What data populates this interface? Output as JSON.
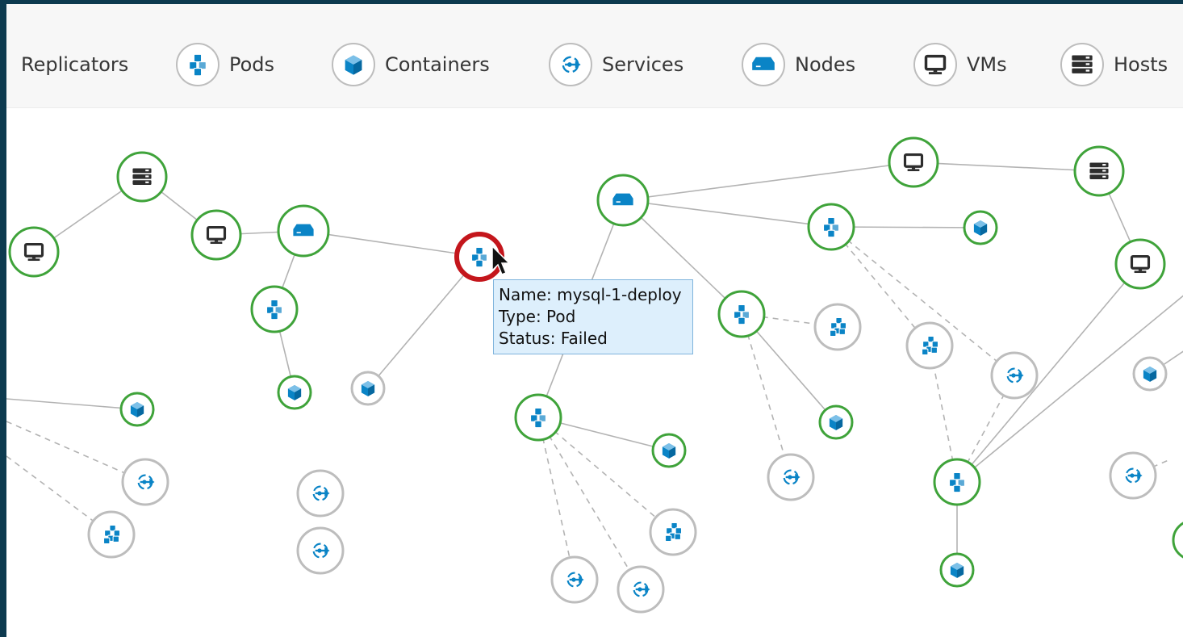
{
  "legend": {
    "items": [
      {
        "label": "Replicators",
        "icon": "replicator-icon"
      },
      {
        "label": "Pods",
        "icon": "pod-icon"
      },
      {
        "label": "Containers",
        "icon": "container-icon"
      },
      {
        "label": "Services",
        "icon": "service-icon"
      },
      {
        "label": "Nodes",
        "icon": "node-icon"
      },
      {
        "label": "VMs",
        "icon": "vm-icon"
      },
      {
        "label": "Hosts",
        "icon": "host-icon"
      }
    ]
  },
  "tooltip": {
    "name": "Name: mysql-1-deploy",
    "type": "Type: Pod",
    "status": "Status: Failed"
  },
  "colors": {
    "active_border": "#3fa33a",
    "inactive_border": "#bdbdbd",
    "failed_border": "#c4161c",
    "icon_blue": "#0a84c6",
    "icon_dark": "#2d2d2d"
  },
  "graph": {
    "nodes": [
      {
        "id": "host1",
        "type": "host",
        "status": "active"
      },
      {
        "id": "vm-left",
        "type": "vm",
        "status": "active"
      },
      {
        "id": "vm2",
        "type": "vm",
        "status": "active"
      },
      {
        "id": "node1",
        "type": "node",
        "status": "active"
      },
      {
        "id": "pod1",
        "type": "pod",
        "status": "active"
      },
      {
        "id": "cont1",
        "type": "container",
        "status": "active"
      },
      {
        "id": "pod-failed",
        "type": "pod",
        "status": "failed"
      },
      {
        "id": "cont-grey1",
        "type": "container",
        "status": "inactive"
      },
      {
        "id": "cont-left",
        "type": "container",
        "status": "active"
      },
      {
        "id": "svc-left1",
        "type": "service",
        "status": "inactive"
      },
      {
        "id": "rep-left1",
        "type": "replicator",
        "status": "inactive"
      },
      {
        "id": "svc-mid1",
        "type": "service",
        "status": "inactive"
      },
      {
        "id": "svc-mid2",
        "type": "service",
        "status": "inactive"
      },
      {
        "id": "node2",
        "type": "node",
        "status": "active"
      },
      {
        "id": "vm3",
        "type": "vm",
        "status": "active"
      },
      {
        "id": "host2",
        "type": "host",
        "status": "active"
      },
      {
        "id": "pod2",
        "type": "pod",
        "status": "active"
      },
      {
        "id": "cont2",
        "type": "container",
        "status": "active"
      },
      {
        "id": "pod3",
        "type": "pod",
        "status": "active"
      },
      {
        "id": "rep2",
        "type": "replicator",
        "status": "inactive"
      },
      {
        "id": "cont3",
        "type": "container",
        "status": "active"
      },
      {
        "id": "svc3",
        "type": "service",
        "status": "inactive"
      },
      {
        "id": "pod4",
        "type": "pod",
        "status": "active"
      },
      {
        "id": "cont4",
        "type": "container",
        "status": "active"
      },
      {
        "id": "rep3",
        "type": "replicator",
        "status": "inactive"
      },
      {
        "id": "svc4",
        "type": "service",
        "status": "inactive"
      },
      {
        "id": "svc5",
        "type": "service",
        "status": "inactive"
      },
      {
        "id": "rep4",
        "type": "replicator",
        "status": "inactive"
      },
      {
        "id": "svc6",
        "type": "service",
        "status": "inactive"
      },
      {
        "id": "pod5",
        "type": "pod",
        "status": "active"
      },
      {
        "id": "cont5",
        "type": "container",
        "status": "active"
      },
      {
        "id": "vm4",
        "type": "vm",
        "status": "active"
      },
      {
        "id": "cont-grey2",
        "type": "container",
        "status": "inactive"
      },
      {
        "id": "svc7",
        "type": "service",
        "status": "inactive"
      },
      {
        "id": "edge-right",
        "type": "container",
        "status": "active"
      }
    ],
    "edges": [
      [
        "vm-left",
        "host1",
        "solid"
      ],
      [
        "host1",
        "vm2",
        "solid"
      ],
      [
        "vm2",
        "node1",
        "solid"
      ],
      [
        "node1",
        "pod1",
        "solid"
      ],
      [
        "pod1",
        "cont1",
        "solid"
      ],
      [
        "node1",
        "pod-failed",
        "solid"
      ],
      [
        "pod-failed",
        "cont-grey1",
        "solid"
      ],
      [
        "node2",
        "vm3",
        "solid"
      ],
      [
        "vm3",
        "host2",
        "solid"
      ],
      [
        "host2",
        "vm4",
        "solid"
      ],
      [
        "node2",
        "pod2",
        "solid"
      ],
      [
        "pod2",
        "cont2",
        "solid"
      ],
      [
        "node2",
        "pod3",
        "solid"
      ],
      [
        "node2",
        "pod4",
        "solid"
      ],
      [
        "pod3",
        "rep2",
        "dashed"
      ],
      [
        "pod3",
        "cont3",
        "solid"
      ],
      [
        "pod3",
        "svc3",
        "dashed"
      ],
      [
        "pod4",
        "cont4",
        "solid"
      ],
      [
        "pod4",
        "rep3",
        "dashed"
      ],
      [
        "pod4",
        "svc4",
        "dashed"
      ],
      [
        "pod4",
        "svc5",
        "dashed"
      ],
      [
        "pod2",
        "rep4",
        "dashed"
      ],
      [
        "pod2",
        "svc6",
        "dashed"
      ],
      [
        "pod5",
        "rep4",
        "dashed"
      ],
      [
        "pod5",
        "svc6",
        "dashed"
      ],
      [
        "pod5",
        "cont5",
        "solid"
      ],
      [
        "pod5",
        "vm4",
        "solid"
      ]
    ]
  }
}
